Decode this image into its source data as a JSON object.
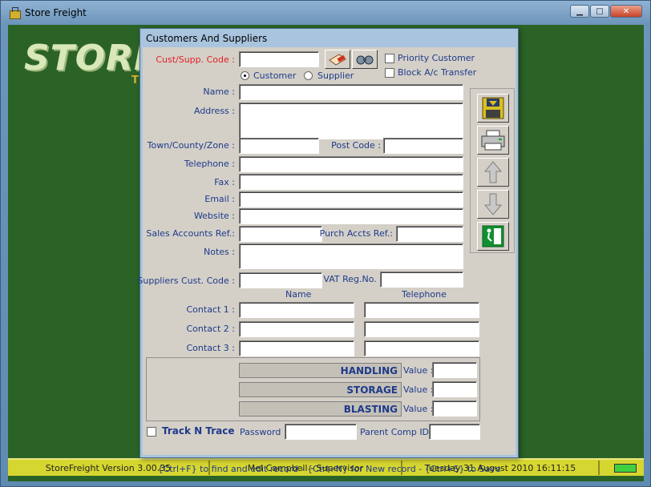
{
  "window": {
    "title": "Store Freight",
    "minimize": "▁",
    "maximize": "□",
    "close": "✕"
  },
  "background": {
    "logo": "STORE",
    "logo_sub": "TI"
  },
  "status_bar": {
    "version": "StoreFreight  Version 3.00.35",
    "user": "Mel Campbell  -  Supervisor",
    "datetime": "Tuesday 31 August 2010  16:11:15"
  },
  "dialog": {
    "title": "Customers And Suppliers",
    "code_label": "Cust/Supp. Code :",
    "code_value": "",
    "type_options": [
      "Customer",
      "Supplier"
    ],
    "type_selected": "Customer",
    "priority_customer": "Priority Customer",
    "block_transfer": "Block A/c Transfer",
    "fields": {
      "name": "Name :",
      "address": "Address :",
      "town": "Town/County/Zone :",
      "postcode": "Post Code :",
      "telephone": "Telephone :",
      "fax": "Fax :",
      "email": "Email :",
      "website": "Website :",
      "sales_ref": "Sales Accounts Ref.:",
      "purch_ref": "Purch Accts Ref.:",
      "notes": "Notes :",
      "suppliers_code": "Suppliers Cust. Code :",
      "vat": "VAT Reg.No. :"
    },
    "contacts": {
      "name_header": "Name",
      "tel_header": "Telephone",
      "rows": [
        "Contact 1 :",
        "Contact 2 :",
        "Contact 3 :"
      ]
    },
    "charges": [
      {
        "label": "HANDLING",
        "value_label": "Value :"
      },
      {
        "label": "STORAGE",
        "value_label": "Value :"
      },
      {
        "label": "BLASTING",
        "value_label": "Value :"
      }
    ],
    "track_n_trace": "Track N Trace",
    "password": "Password :",
    "parent_comp": "Parent Comp ID:",
    "hint": "{Ctrl+F} to find and edit record - {Ctrl+N} for New record - {Ctrl+S} to Save"
  },
  "icons": [
    "save-icon",
    "print-icon",
    "arrow-up-icon",
    "arrow-down-icon",
    "exit-icon",
    "edit-icon",
    "binoculars-icon"
  ],
  "colors": {
    "label_blue": "#1e3a8a",
    "code_red": "#e02020",
    "status_yellow": "#d6d630",
    "bg_green": "#2b6327"
  }
}
